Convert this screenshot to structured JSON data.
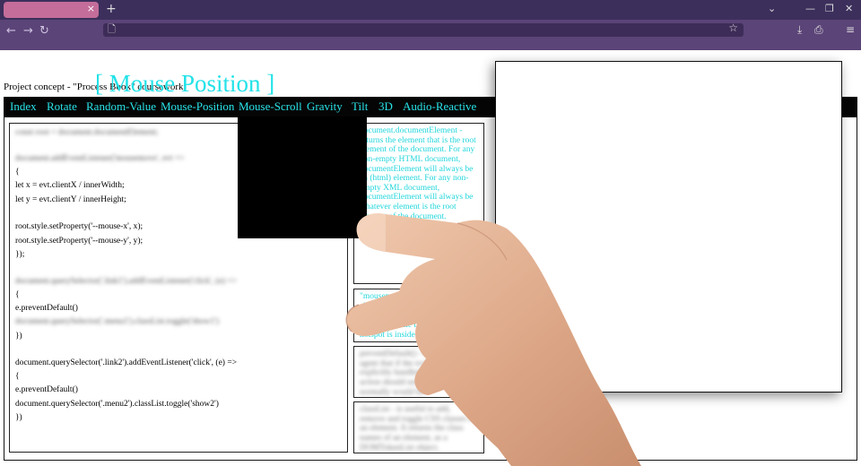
{
  "browser": {
    "tab_close": "×",
    "new_tab": "+",
    "nav": {
      "back": "←",
      "forward": "→",
      "reload": "↻"
    },
    "url_icon": "🗋",
    "bookmark_icon": "☆",
    "window_controls": {
      "minimize": "—",
      "maximize": "❐",
      "close": "✕",
      "chevron": "⌄"
    },
    "toolbar": {
      "download": "⤓",
      "extensions": "⎙",
      "menu": "≡"
    }
  },
  "page": {
    "concept_text": "Project concept - \"Process Book\" coursework",
    "title": "[ Mouse Position ]",
    "menu": [
      "Index",
      "Rotate",
      "Random-Value",
      "Mouse-Position",
      "Mouse-Scroll",
      "Gravity",
      "Tilt",
      "3D",
      "Audio-Reactive"
    ]
  },
  "code": {
    "l1": "const root = document.documentElement;",
    "l2": "document.addEventListener('mousemove', evt =>",
    "l3": "{",
    "l4": "let x = evt.clientX / innerWidth;",
    "l5": "let y = evt.clientY / innerHeight;",
    "l6": "root.style.setProperty('--mouse-x', x);",
    "l7": "root.style.setProperty('--mouse-y', y);",
    "l8": "});",
    "l9": "document.querySelector('.link1').addEventListener('click', (e) =>",
    "l10": "{",
    "l11": "e.preventDefault()",
    "l12": "document.querySelector('.menu1').classList.toggle('show1')",
    "l13": "})",
    "l14": "document.querySelector('.link2').addEventListener('click', (e) =>",
    "l15": "{",
    "l16": "e.preventDefault()",
    "l17": "document.querySelector('.menu2').classList.toggle('show2')",
    "l18": "})"
  },
  "info": {
    "doc_element": "document.documentElement - returns the element that is the root element of the document. For any non-empty HTML document, documentElement will always be an (html) element. For any non-empty XML document, documentElement will always be whatever element is the root element of the document.",
    "doc_element_tail": "el",
    "mousemove": "\"mousemove\" - is fired at an element, as an event, when a pointing device (usually a mouse) is moved while the cursor's hotspot is inside it.",
    "prevent_default": "preventDefault() - tells the user agent that if the event does not get explicitly handled, its default action should not be taken as it normally would be.",
    "classlist": "classList - is useful to add, remove and toggle CSS classes on an element. It returns the class names of an element, as a DOMTokenList object."
  }
}
